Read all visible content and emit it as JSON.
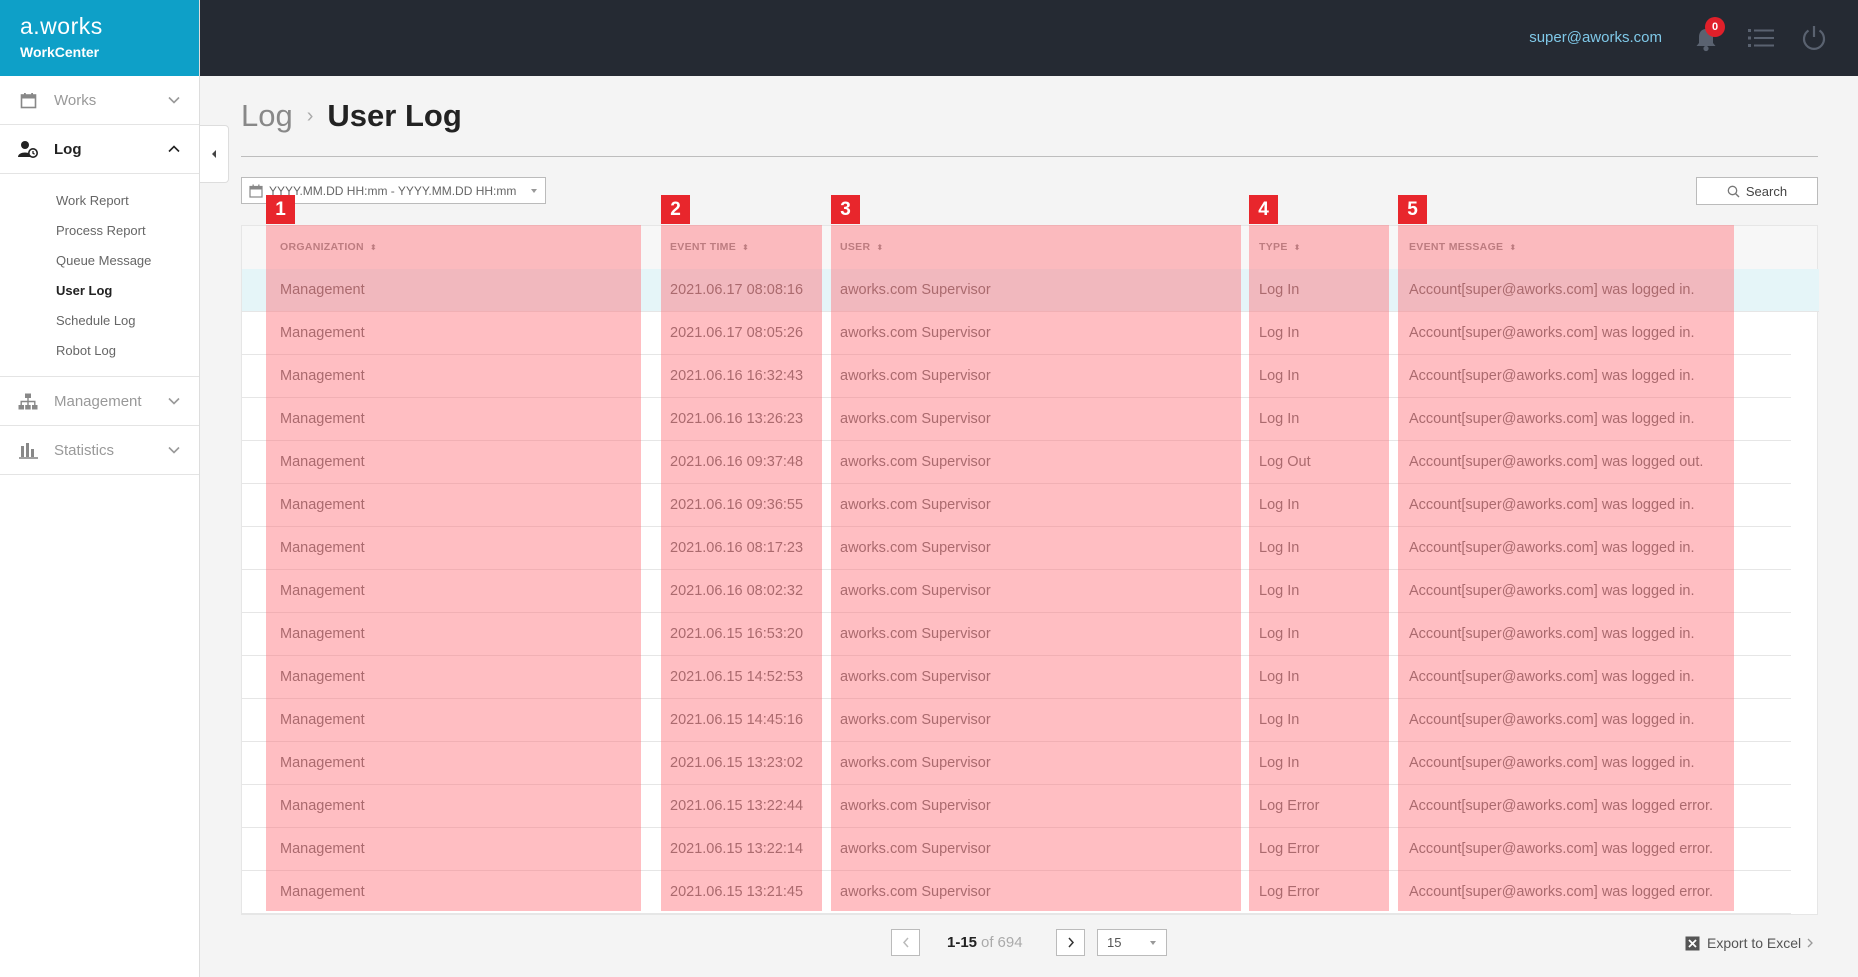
{
  "brand": {
    "logo": "a.works",
    "subtitle": "WorkCenter"
  },
  "user": {
    "email": "super@aworks.com",
    "notifications": "0"
  },
  "sidebar": {
    "items": [
      {
        "label": "Works",
        "icon": "calendar-icon",
        "expanded": false
      },
      {
        "label": "Log",
        "icon": "user-clock-icon",
        "expanded": true,
        "children": [
          "Work Report",
          "Process Report",
          "Queue Message",
          "User Log",
          "Schedule Log",
          "Robot Log"
        ]
      },
      {
        "label": "Management",
        "icon": "org-chart-icon",
        "expanded": false
      },
      {
        "label": "Statistics",
        "icon": "bar-chart-icon",
        "expanded": false
      }
    ],
    "current_child": "User Log"
  },
  "breadcrumb": {
    "parent": "Log",
    "separator": "›",
    "title": "User Log"
  },
  "filters": {
    "date_range_placeholder": "YYYY.MM.DD HH:mm - YYYY.MM.DD HH:mm",
    "search_label": "Search"
  },
  "table": {
    "columns": [
      "ORGANIZATION",
      "EVENT TIME",
      "USER",
      "TYPE",
      "EVENT MESSAGE"
    ],
    "rows": [
      [
        "Management",
        "2021.06.17 08:08:16",
        "aworks.com Supervisor",
        "Log In",
        "Account[super@aworks.com] was logged in."
      ],
      [
        "Management",
        "2021.06.17 08:05:26",
        "aworks.com Supervisor",
        "Log In",
        "Account[super@aworks.com] was logged in."
      ],
      [
        "Management",
        "2021.06.16 16:32:43",
        "aworks.com Supervisor",
        "Log In",
        "Account[super@aworks.com] was logged in."
      ],
      [
        "Management",
        "2021.06.16 13:26:23",
        "aworks.com Supervisor",
        "Log In",
        "Account[super@aworks.com] was logged in."
      ],
      [
        "Management",
        "2021.06.16 09:37:48",
        "aworks.com Supervisor",
        "Log Out",
        "Account[super@aworks.com] was logged out."
      ],
      [
        "Management",
        "2021.06.16 09:36:55",
        "aworks.com Supervisor",
        "Log In",
        "Account[super@aworks.com] was logged in."
      ],
      [
        "Management",
        "2021.06.16 08:17:23",
        "aworks.com Supervisor",
        "Log In",
        "Account[super@aworks.com] was logged in."
      ],
      [
        "Management",
        "2021.06.16 08:02:32",
        "aworks.com Supervisor",
        "Log In",
        "Account[super@aworks.com] was logged in."
      ],
      [
        "Management",
        "2021.06.15 16:53:20",
        "aworks.com Supervisor",
        "Log In",
        "Account[super@aworks.com] was logged in."
      ],
      [
        "Management",
        "2021.06.15 14:52:53",
        "aworks.com Supervisor",
        "Log In",
        "Account[super@aworks.com] was logged in."
      ],
      [
        "Management",
        "2021.06.15 14:45:16",
        "aworks.com Supervisor",
        "Log In",
        "Account[super@aworks.com] was logged in."
      ],
      [
        "Management",
        "2021.06.15 13:23:02",
        "aworks.com Supervisor",
        "Log In",
        "Account[super@aworks.com] was logged in."
      ],
      [
        "Management",
        "2021.06.15 13:22:44",
        "aworks.com Supervisor",
        "Log Error",
        "Account[super@aworks.com] was logged error."
      ],
      [
        "Management",
        "2021.06.15 13:22:14",
        "aworks.com Supervisor",
        "Log Error",
        "Account[super@aworks.com] was logged error."
      ],
      [
        "Management",
        "2021.06.15 13:21:45",
        "aworks.com Supervisor",
        "Log Error",
        "Account[super@aworks.com] was logged error."
      ]
    ],
    "selected_row": 0
  },
  "annotations": [
    "1",
    "2",
    "3",
    "4",
    "5"
  ],
  "pagination": {
    "range": "1-15",
    "of": "of",
    "total": "694",
    "page_size": "15"
  },
  "export_label": "Export to Excel",
  "colors": {
    "brand": "#0ea0c8",
    "topbar": "#252a33",
    "highlight": "#ff6e78",
    "marker": "#e8262c",
    "selected_row": "#e5f5f8"
  }
}
